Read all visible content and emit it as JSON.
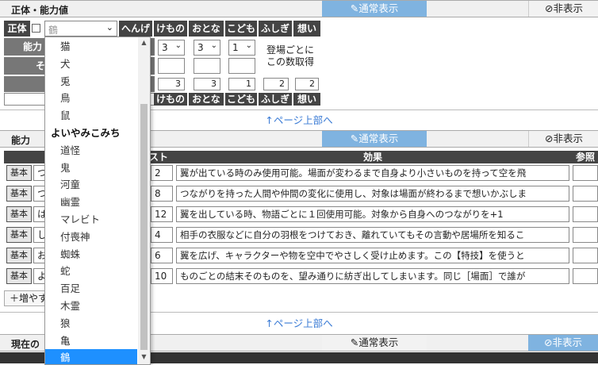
{
  "modes": {
    "normal": "✎通常表示",
    "hidden": "⊘非表示"
  },
  "section1": {
    "title": "正体・能力値",
    "shotai_label": "正体",
    "shotai_value": "鶴",
    "cols": [
      "へんげ",
      "けもの",
      "おとな",
      "こども",
      "ふしぎ",
      "想い"
    ],
    "row_label_ability": "能力",
    "row_label_other": "そ",
    "sel_kemono": "3",
    "sel_otona": "3",
    "sel_kodomo": "1",
    "note": "登場ごとに\nこの数取得",
    "totals": {
      "kemono": "3",
      "otona": "3",
      "kodomo": "1",
      "fushigi": "2",
      "omoi": "2"
    },
    "footer_cols": [
      "けもの",
      "おとな",
      "こども",
      "ふしぎ",
      "想い"
    ]
  },
  "pagetop": "↑ページ上部へ",
  "section2": {
    "title": "能力",
    "headers": {
      "cost": "スト",
      "effect": "効果",
      "ref": "参照"
    },
    "rows": [
      {
        "type": "基本",
        "name": "つ",
        "cost": "2",
        "effect": "翼が出ている時のみ使用可能。場面が変わるまで自身より小さいものを持って空を飛"
      },
      {
        "type": "基本",
        "name": "つ",
        "cost": "8",
        "effect": "つながりを持った人間や仲間の変化に使用し、対象は場面が終わるまで想いかぶしま"
      },
      {
        "type": "基本",
        "name": "は",
        "cost": "12",
        "effect": "翼を出している時、物語ごとに１回使用可能。対象から自身へのつながりを+1"
      },
      {
        "type": "基本",
        "name": "し",
        "cost": "4",
        "effect": "相手の衣服などに自分の羽根をつけておき、離れていてもその言動や居場所を知るこ"
      },
      {
        "type": "基本",
        "name": "お",
        "cost": "6",
        "effect": "翼を広げ、キャラクターや物を空中でやさしく受け止めます。この【特技】を使うと"
      },
      {
        "type": "基本",
        "name": "よ",
        "cost": "10",
        "effect": "ものごとの結末そのものを、望み通りに紡ぎ出してしまいます。同じ［場面］で誰が"
      }
    ],
    "add_button": "＋増やす"
  },
  "section3": {
    "title": "現在の"
  },
  "dropdown": {
    "options": [
      {
        "label": "猫",
        "group": false
      },
      {
        "label": "犬",
        "group": false
      },
      {
        "label": "兎",
        "group": false
      },
      {
        "label": "鳥",
        "group": false
      },
      {
        "label": "鼠",
        "group": false
      },
      {
        "label": "よいやみこみち",
        "group": true
      },
      {
        "label": "道怪",
        "group": false
      },
      {
        "label": "鬼",
        "group": false
      },
      {
        "label": "河童",
        "group": false
      },
      {
        "label": "幽霊",
        "group": false
      },
      {
        "label": "マレビト",
        "group": false
      },
      {
        "label": "付喪神",
        "group": false
      },
      {
        "label": "蜘蛛",
        "group": false
      },
      {
        "label": "蛇",
        "group": false
      },
      {
        "label": "百足",
        "group": false
      },
      {
        "label": "木霊",
        "group": false
      },
      {
        "label": "狼",
        "group": false
      },
      {
        "label": "亀",
        "group": false
      },
      {
        "label": "鶴",
        "group": false,
        "selected": true
      }
    ]
  }
}
